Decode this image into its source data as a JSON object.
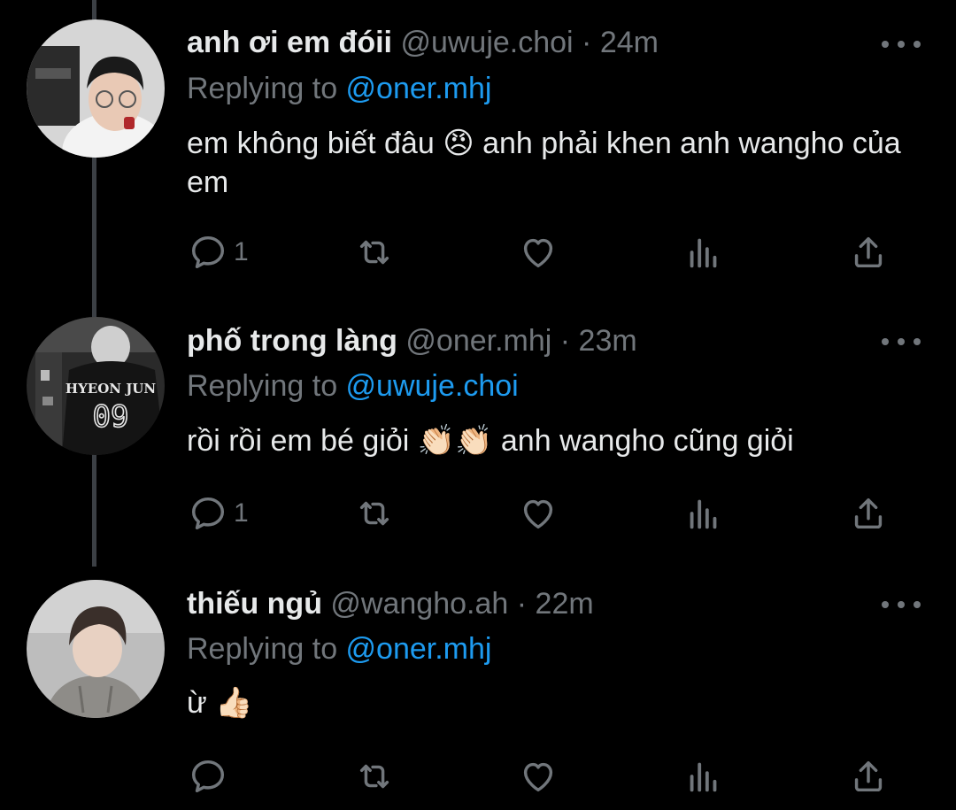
{
  "tweets": [
    {
      "name": "anh ơi em đóii",
      "handle": "@uwuje.choi",
      "time": "24m",
      "replying_prefix": "Replying to ",
      "replying_to": "@oner.mhj",
      "text_before": "em không biết đâu ",
      "emoji": "😠",
      "text_after": " anh phải khen anh wangho của em",
      "reply_count": "1",
      "avatar_icon": "avatar-photo-glasses",
      "avatar_bg": "#d9d9d9"
    },
    {
      "name": "phố trong làng",
      "handle": "@oner.mhj",
      "time": "23m",
      "replying_prefix": "Replying to ",
      "replying_to": "@uwuje.choi",
      "text_before": "rồi rồi em bé giỏi ",
      "emoji": "👏🏻👏🏻",
      "text_after": " anh wangho cũng giỏi",
      "reply_count": "1",
      "avatar_icon": "avatar-photo-jersey",
      "avatar_jersey_name": "HYEON JUN",
      "avatar_jersey_number": "09",
      "avatar_bg": "#2a2a2a"
    },
    {
      "name": "thiếu ngủ",
      "handle": "@wangho.ah",
      "time": "22m",
      "replying_prefix": "Replying to ",
      "replying_to": "@oner.mhj",
      "text_before": "ừ ",
      "emoji": "👍🏻",
      "text_after": "",
      "reply_count": "",
      "avatar_icon": "avatar-photo-hoodie",
      "avatar_bg": "#b9b9b9"
    }
  ],
  "separator": " · ",
  "colors": {
    "background": "#000000",
    "text": "#e7e9ea",
    "secondary": "#71767b",
    "mention": "#1d9bf0",
    "thread_line": "#3b3f44"
  },
  "icons": [
    "reply-icon",
    "retweet-icon",
    "like-icon",
    "views-icon",
    "share-icon",
    "more-icon"
  ]
}
